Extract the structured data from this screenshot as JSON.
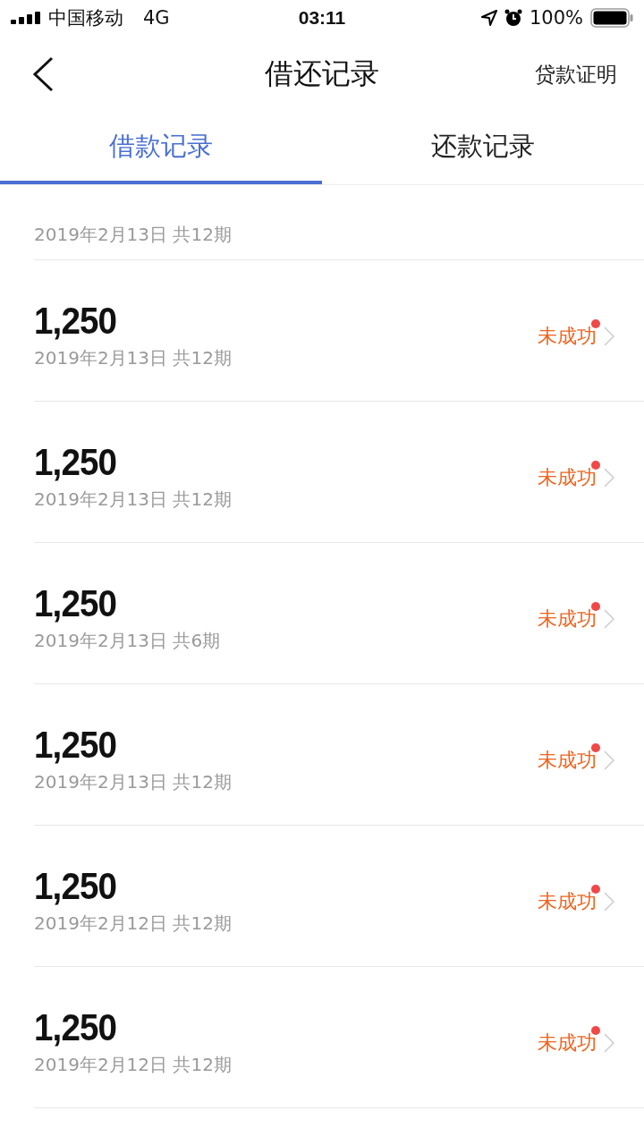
{
  "status_bar": {
    "carrier": "中国移动",
    "network": "4G",
    "time": "03:11",
    "battery": "100%"
  },
  "nav": {
    "title": "借还记录",
    "action": "贷款证明"
  },
  "tabs": [
    {
      "label": "借款记录",
      "selected": true
    },
    {
      "label": "还款记录",
      "selected": false
    }
  ],
  "records": [
    {
      "date": "2019年2月13日 共12期"
    },
    {
      "amount": "1,250",
      "date": "2019年2月13日 共12期",
      "status": "未成功",
      "unread": true
    },
    {
      "amount": "1,250",
      "date": "2019年2月13日 共12期",
      "status": "未成功",
      "unread": true
    },
    {
      "amount": "1,250",
      "date": "2019年2月13日 共6期",
      "status": "未成功",
      "unread": true
    },
    {
      "amount": "1,250",
      "date": "2019年2月13日 共12期",
      "status": "未成功",
      "unread": true
    },
    {
      "amount": "1,250",
      "date": "2019年2月12日 共12期",
      "status": "未成功",
      "unread": true
    },
    {
      "amount": "1,250",
      "date": "2019年2月12日 共12期",
      "status": "未成功",
      "unread": true
    }
  ]
}
